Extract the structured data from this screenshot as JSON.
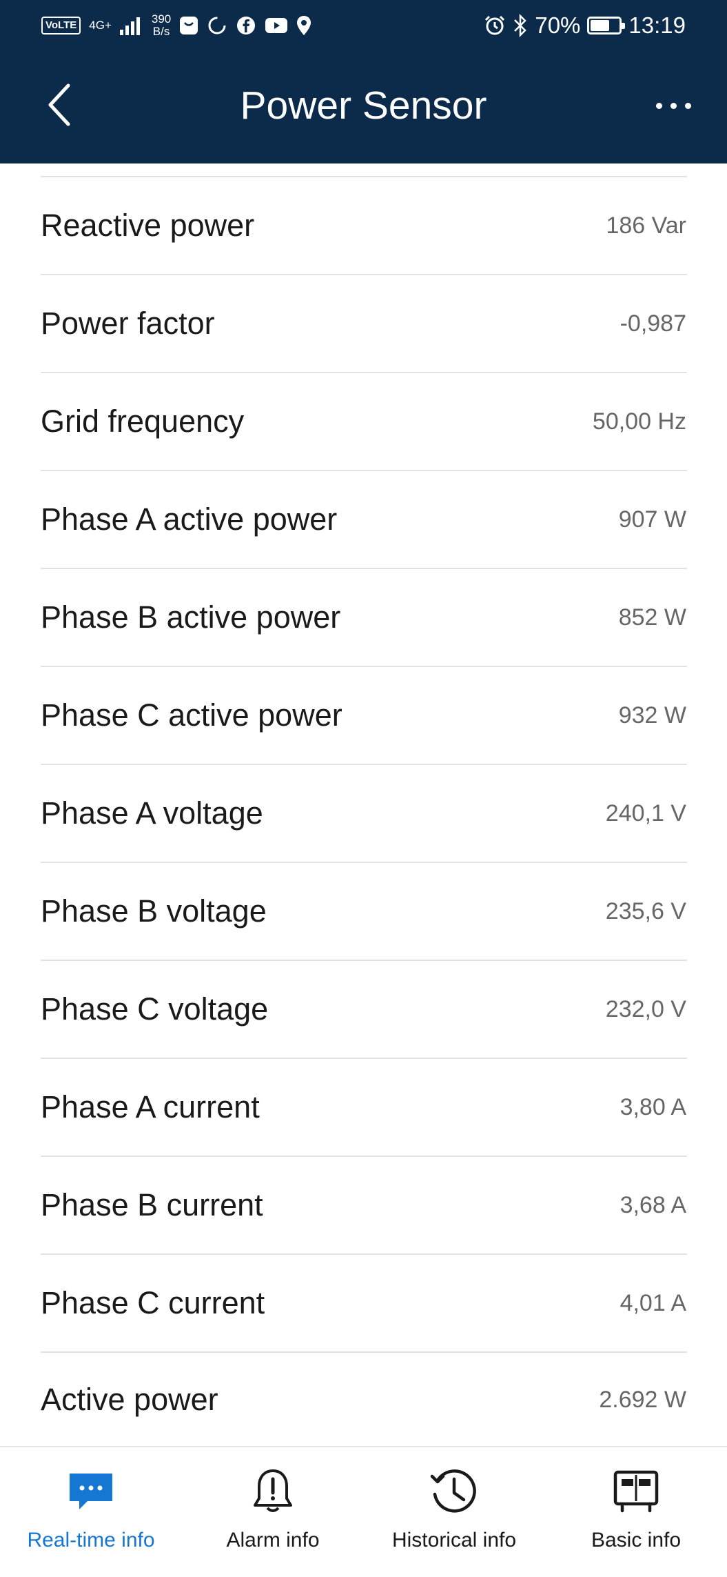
{
  "status_bar": {
    "volte": "VoLTE",
    "network": "4G+",
    "speed_value": "390",
    "speed_unit": "B/s",
    "battery_percent": "70%",
    "battery_level": 0.7,
    "time": "13:19"
  },
  "header": {
    "title": "Power Sensor"
  },
  "rows": [
    {
      "label": "Reactive power",
      "value": "186 Var"
    },
    {
      "label": "Power factor",
      "value": "-0,987"
    },
    {
      "label": "Grid frequency",
      "value": "50,00 Hz"
    },
    {
      "label": "Phase A active power",
      "value": "907 W"
    },
    {
      "label": "Phase B active power",
      "value": "852 W"
    },
    {
      "label": "Phase C active power",
      "value": "932 W"
    },
    {
      "label": "Phase A voltage",
      "value": "240,1 V"
    },
    {
      "label": "Phase B voltage",
      "value": "235,6 V"
    },
    {
      "label": "Phase C voltage",
      "value": "232,0 V"
    },
    {
      "label": "Phase A current",
      "value": "3,80 A"
    },
    {
      "label": "Phase B current",
      "value": "3,68 A"
    },
    {
      "label": "Phase C current",
      "value": "4,01 A"
    },
    {
      "label": "Active power",
      "value": "2.692 W"
    }
  ],
  "nav": [
    {
      "label": "Real-time info",
      "icon": "chat-bubble-icon",
      "active": true
    },
    {
      "label": "Alarm info",
      "icon": "alarm-bell-icon",
      "active": false
    },
    {
      "label": "Historical info",
      "icon": "clock-history-icon",
      "active": false
    },
    {
      "label": "Basic info",
      "icon": "device-info-icon",
      "active": false
    }
  ],
  "colors": {
    "header_bg": "#0c2a4a",
    "accent": "#1677d2",
    "value_text": "#666666",
    "label_text": "#1a1a1a"
  }
}
